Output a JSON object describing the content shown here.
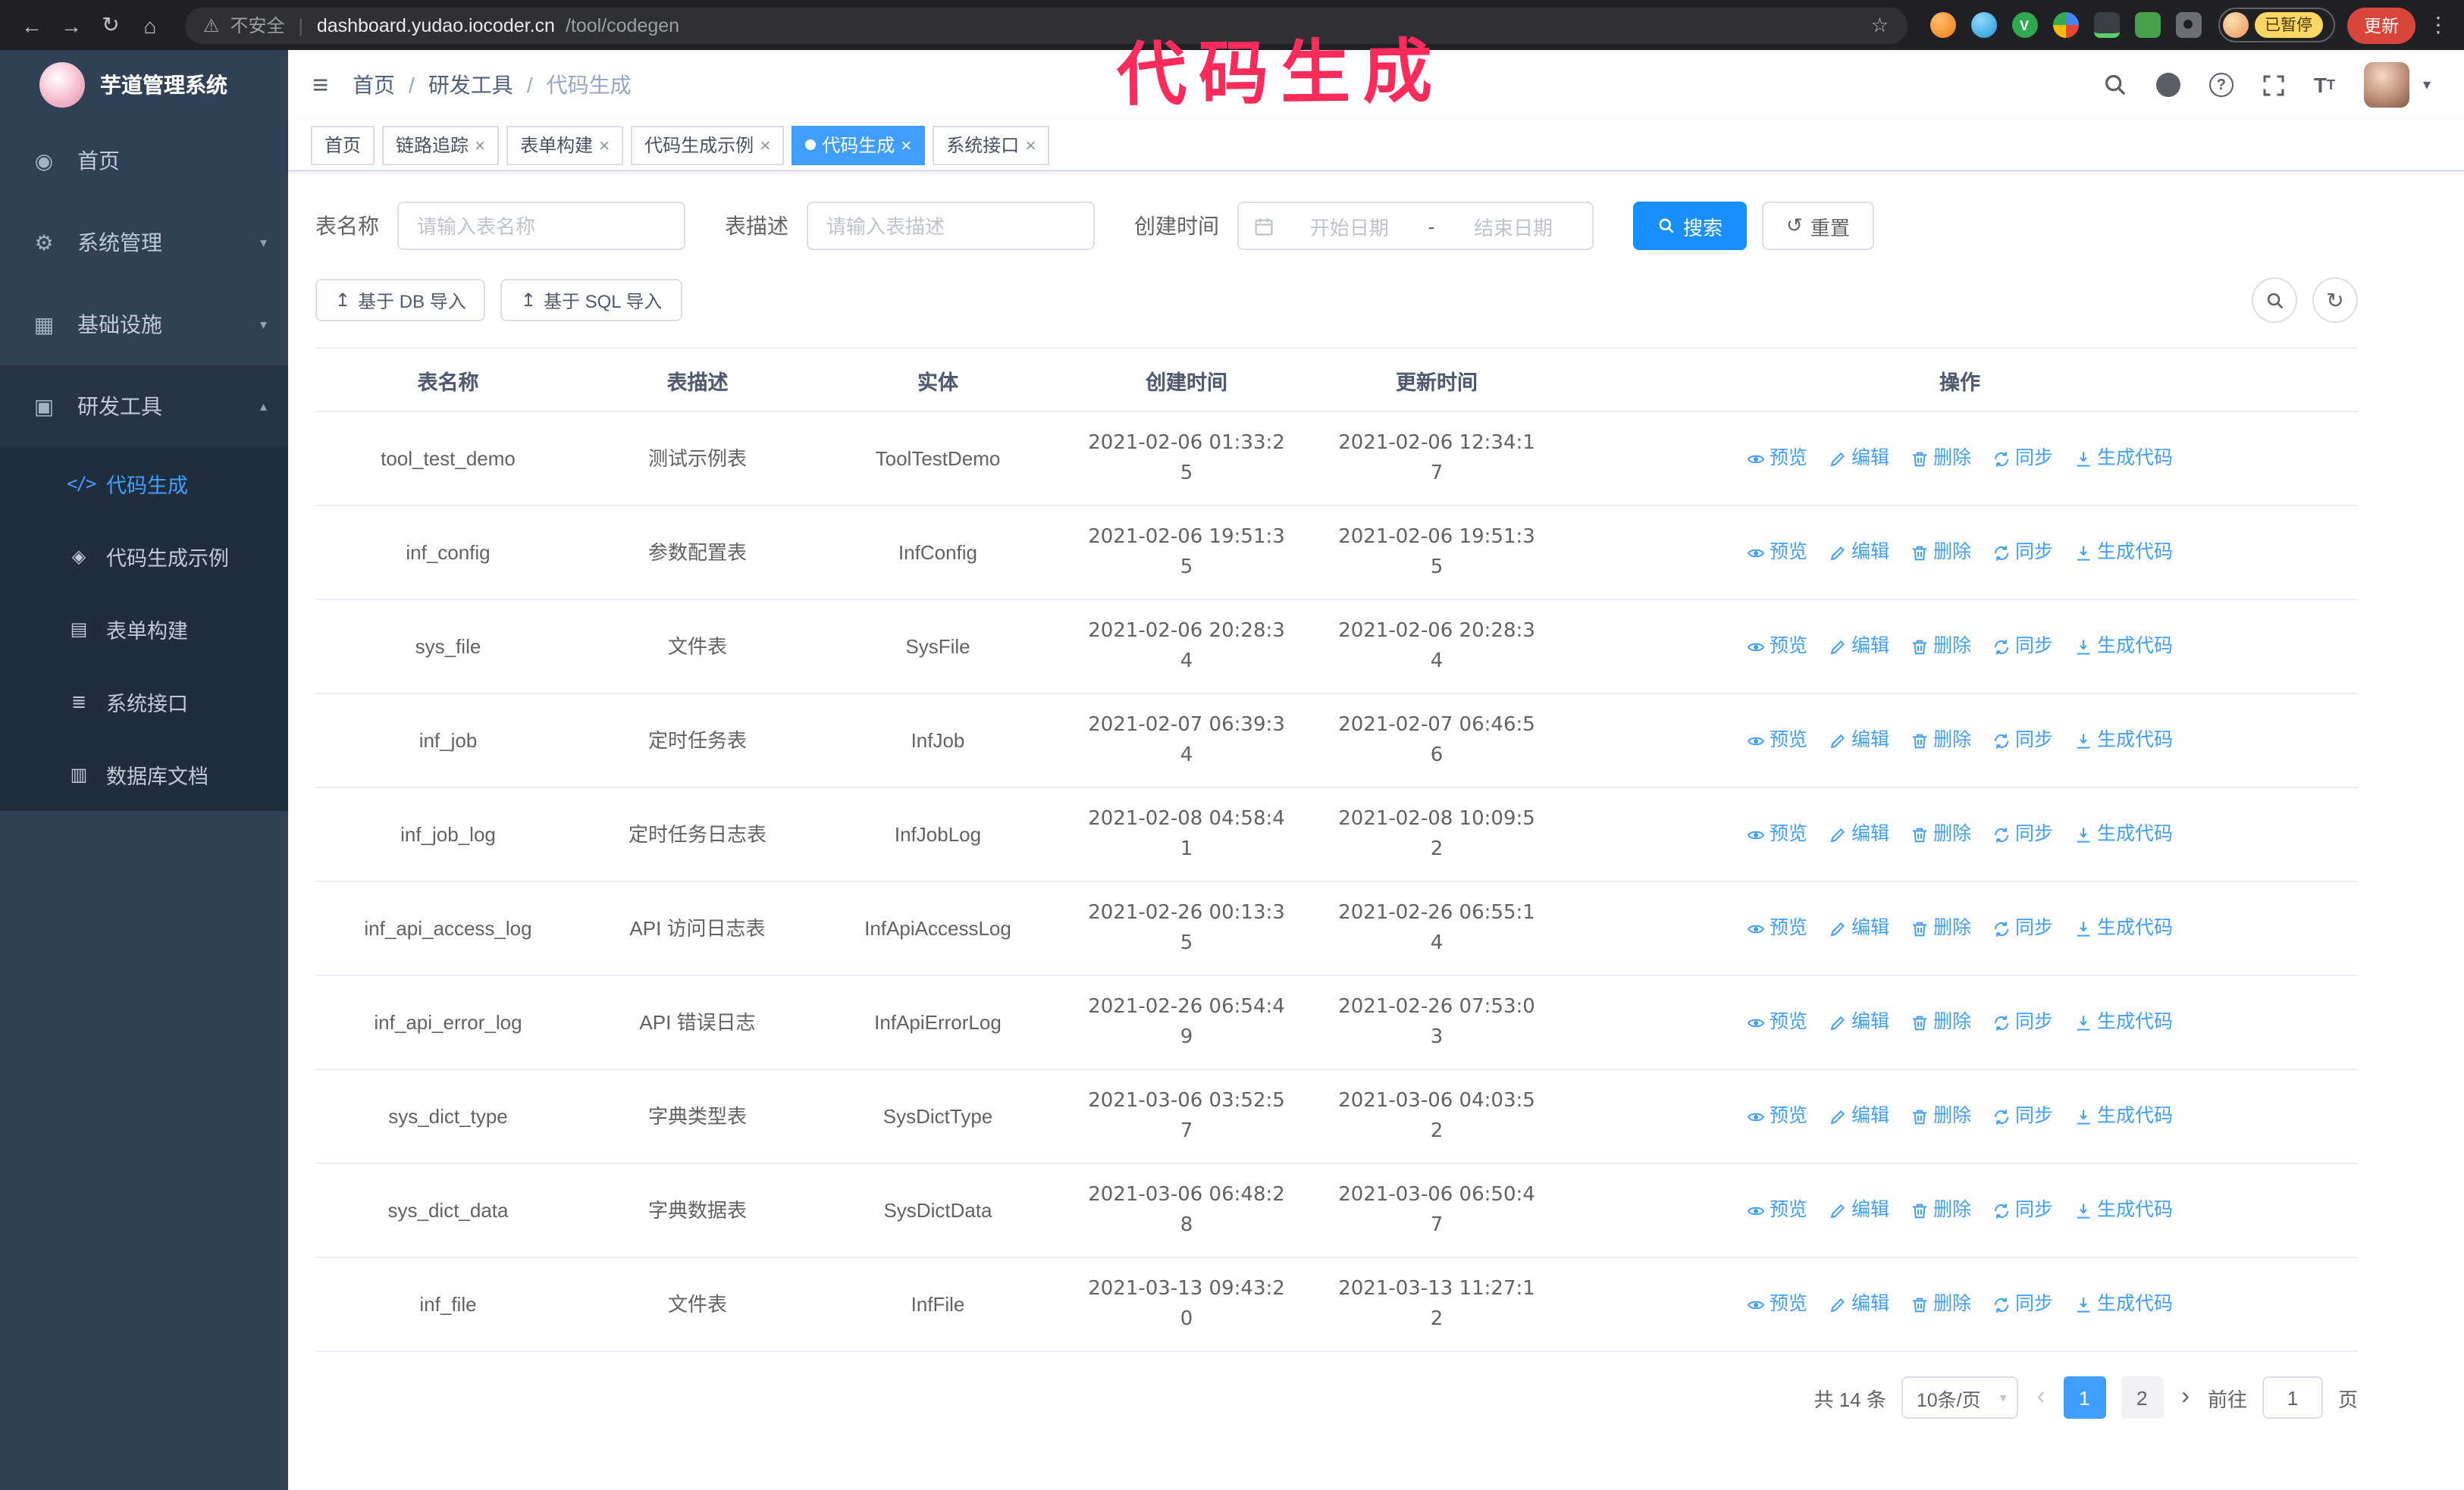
{
  "colors": {
    "primary": "#409eff",
    "search-button": "#1890ff",
    "tag-active": "#409eff",
    "annotation": "#fb2c5c",
    "update-button": "#d9453b",
    "paused-badge": "#fdd663",
    "sidebar-bg": "#304156",
    "submenu-bg": "#1f2d3d",
    "browser-bar-bg": "#202124"
  },
  "annotation": {
    "text": "代码生成"
  },
  "browser": {
    "security_label": "不安全",
    "url_host": "dashboard.yudao.iocoder.cn",
    "url_path": "/tool/codegen",
    "profile_badge_label": "已暂停",
    "update_button_label": "更新"
  },
  "icons": {
    "back": "←",
    "forward": "→",
    "reload": "↻",
    "home": "⌂",
    "warning": "⚠",
    "star": "☆",
    "menu_dots": "⋮",
    "hamburger": "≡",
    "caret_down": "▾",
    "caret_up": "▴",
    "close": "×",
    "dashboard": "◉",
    "gear": "⚙",
    "infra": "▦",
    "tools": "▣",
    "code": "</>",
    "example": "◈",
    "form": "▤",
    "api": "≣",
    "dbdoc": "▥",
    "upload": "↥",
    "reset": "↺",
    "refresh": "↻",
    "prev": "‹",
    "next": "›",
    "question": "?",
    "font_size": "T",
    "ext_green_letter": "V"
  },
  "sidebar": {
    "app_title": "芋道管理系统",
    "items": [
      {
        "label": "首页"
      },
      {
        "label": "系统管理",
        "expandable": true
      },
      {
        "label": "基础设施",
        "expandable": true
      },
      {
        "label": "研发工具",
        "expandable": true,
        "expanded": true,
        "children": [
          {
            "label": "代码生成",
            "active": true
          },
          {
            "label": "代码生成示例"
          },
          {
            "label": "表单构建"
          },
          {
            "label": "系统接口"
          },
          {
            "label": "数据库文档"
          }
        ]
      }
    ]
  },
  "breadcrumb": {
    "items": [
      "首页",
      "研发工具",
      "代码生成"
    ],
    "separator": "/"
  },
  "tabs": [
    {
      "label": "首页",
      "active": false,
      "closable": false
    },
    {
      "label": "链路追踪",
      "active": false,
      "closable": true
    },
    {
      "label": "表单构建",
      "active": false,
      "closable": true
    },
    {
      "label": "代码生成示例",
      "active": false,
      "closable": true
    },
    {
      "label": "代码生成",
      "active": true,
      "closable": true
    },
    {
      "label": "系统接口",
      "active": false,
      "closable": true
    }
  ],
  "filters": {
    "table_name_label": "表名称",
    "table_name_placeholder": "请输入表名称",
    "table_desc_label": "表描述",
    "table_desc_placeholder": "请输入表描述",
    "create_time_label": "创建时间",
    "date_start_placeholder": "开始日期",
    "date_separator": "-",
    "date_end_placeholder": "结束日期",
    "search_label": "搜索",
    "reset_label": "重置"
  },
  "toolbar": {
    "import_db_label": "基于 DB 导入",
    "import_sql_label": "基于 SQL 导入"
  },
  "table": {
    "columns": [
      "表名称",
      "表描述",
      "实体",
      "创建时间",
      "更新时间",
      "操作"
    ],
    "row_actions": [
      "预览",
      "编辑",
      "删除",
      "同步",
      "生成代码"
    ],
    "rows": [
      {
        "name": "tool_test_demo",
        "desc": "测试示例表",
        "entity": "ToolTestDemo",
        "created": "2021-02-06 01:33:25",
        "updated": "2021-02-06 12:34:17"
      },
      {
        "name": "inf_config",
        "desc": "参数配置表",
        "entity": "InfConfig",
        "created": "2021-02-06 19:51:35",
        "updated": "2021-02-06 19:51:35"
      },
      {
        "name": "sys_file",
        "desc": "文件表",
        "entity": "SysFile",
        "created": "2021-02-06 20:28:34",
        "updated": "2021-02-06 20:28:34"
      },
      {
        "name": "inf_job",
        "desc": "定时任务表",
        "entity": "InfJob",
        "created": "2021-02-07 06:39:34",
        "updated": "2021-02-07 06:46:56"
      },
      {
        "name": "inf_job_log",
        "desc": "定时任务日志表",
        "entity": "InfJobLog",
        "created": "2021-02-08 04:58:41",
        "updated": "2021-02-08 10:09:52"
      },
      {
        "name": "inf_api_access_log",
        "desc": "API 访问日志表",
        "entity": "InfApiAccessLog",
        "created": "2021-02-26 00:13:35",
        "updated": "2021-02-26 06:55:14"
      },
      {
        "name": "inf_api_error_log",
        "desc": "API 错误日志",
        "entity": "InfApiErrorLog",
        "created": "2021-02-26 06:54:49",
        "updated": "2021-02-26 07:53:03"
      },
      {
        "name": "sys_dict_type",
        "desc": "字典类型表",
        "entity": "SysDictType",
        "created": "2021-03-06 03:52:57",
        "updated": "2021-03-06 04:03:52"
      },
      {
        "name": "sys_dict_data",
        "desc": "字典数据表",
        "entity": "SysDictData",
        "created": "2021-03-06 06:48:28",
        "updated": "2021-03-06 06:50:47"
      },
      {
        "name": "inf_file",
        "desc": "文件表",
        "entity": "InfFile",
        "created": "2021-03-13 09:43:20",
        "updated": "2021-03-13 11:27:12"
      }
    ]
  },
  "pagination": {
    "total_label": "共 14 条",
    "page_size_label": "10条/页",
    "pages": [
      "1",
      "2"
    ],
    "active_page": "1",
    "goto_prefix": "前往",
    "goto_value": "1",
    "goto_suffix": "页"
  }
}
